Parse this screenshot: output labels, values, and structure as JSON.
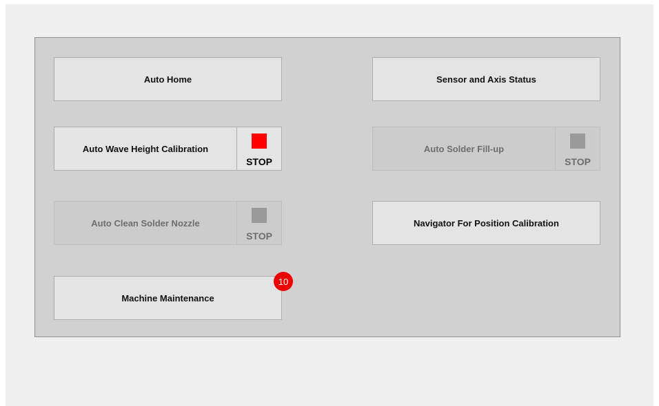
{
  "buttons": {
    "auto_home": "Auto Home",
    "sensor_axis_status": "Sensor and Axis Status",
    "auto_wave_height_calibration": "Auto Wave Height Calibration",
    "auto_solder_fillup": "Auto Solder Fill-up",
    "auto_clean_solder_nozzle": "Auto Clean Solder Nozzle",
    "navigator_position_calibration": "Navigator For Position Calibration",
    "machine_maintenance": "Machine Maintenance"
  },
  "stop": {
    "wave_height_label": "STOP",
    "solder_fillup_label": "STOP",
    "clean_nozzle_label": "STOP"
  },
  "maintenance_badge": "10",
  "colors": {
    "stop_active": "#ff0000",
    "stop_inactive": "#9a9a9a",
    "badge": "#ee0000",
    "panel_bg": "#d1d1d1",
    "button_bg": "#e4e4e4"
  }
}
